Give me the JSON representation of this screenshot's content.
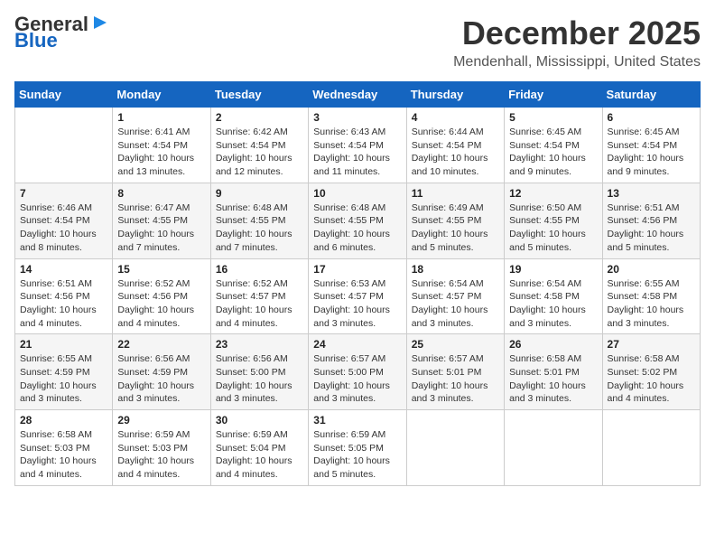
{
  "header": {
    "logo_line1": "General",
    "logo_line2": "Blue",
    "month_title": "December 2025",
    "location": "Mendenhall, Mississippi, United States"
  },
  "days_of_week": [
    "Sunday",
    "Monday",
    "Tuesday",
    "Wednesday",
    "Thursday",
    "Friday",
    "Saturday"
  ],
  "weeks": [
    [
      {
        "day": "",
        "info": ""
      },
      {
        "day": "1",
        "info": "Sunrise: 6:41 AM\nSunset: 4:54 PM\nDaylight: 10 hours\nand 13 minutes."
      },
      {
        "day": "2",
        "info": "Sunrise: 6:42 AM\nSunset: 4:54 PM\nDaylight: 10 hours\nand 12 minutes."
      },
      {
        "day": "3",
        "info": "Sunrise: 6:43 AM\nSunset: 4:54 PM\nDaylight: 10 hours\nand 11 minutes."
      },
      {
        "day": "4",
        "info": "Sunrise: 6:44 AM\nSunset: 4:54 PM\nDaylight: 10 hours\nand 10 minutes."
      },
      {
        "day": "5",
        "info": "Sunrise: 6:45 AM\nSunset: 4:54 PM\nDaylight: 10 hours\nand 9 minutes."
      },
      {
        "day": "6",
        "info": "Sunrise: 6:45 AM\nSunset: 4:54 PM\nDaylight: 10 hours\nand 9 minutes."
      }
    ],
    [
      {
        "day": "7",
        "info": "Sunrise: 6:46 AM\nSunset: 4:54 PM\nDaylight: 10 hours\nand 8 minutes."
      },
      {
        "day": "8",
        "info": "Sunrise: 6:47 AM\nSunset: 4:55 PM\nDaylight: 10 hours\nand 7 minutes."
      },
      {
        "day": "9",
        "info": "Sunrise: 6:48 AM\nSunset: 4:55 PM\nDaylight: 10 hours\nand 7 minutes."
      },
      {
        "day": "10",
        "info": "Sunrise: 6:48 AM\nSunset: 4:55 PM\nDaylight: 10 hours\nand 6 minutes."
      },
      {
        "day": "11",
        "info": "Sunrise: 6:49 AM\nSunset: 4:55 PM\nDaylight: 10 hours\nand 5 minutes."
      },
      {
        "day": "12",
        "info": "Sunrise: 6:50 AM\nSunset: 4:55 PM\nDaylight: 10 hours\nand 5 minutes."
      },
      {
        "day": "13",
        "info": "Sunrise: 6:51 AM\nSunset: 4:56 PM\nDaylight: 10 hours\nand 5 minutes."
      }
    ],
    [
      {
        "day": "14",
        "info": "Sunrise: 6:51 AM\nSunset: 4:56 PM\nDaylight: 10 hours\nand 4 minutes."
      },
      {
        "day": "15",
        "info": "Sunrise: 6:52 AM\nSunset: 4:56 PM\nDaylight: 10 hours\nand 4 minutes."
      },
      {
        "day": "16",
        "info": "Sunrise: 6:52 AM\nSunset: 4:57 PM\nDaylight: 10 hours\nand 4 minutes."
      },
      {
        "day": "17",
        "info": "Sunrise: 6:53 AM\nSunset: 4:57 PM\nDaylight: 10 hours\nand 3 minutes."
      },
      {
        "day": "18",
        "info": "Sunrise: 6:54 AM\nSunset: 4:57 PM\nDaylight: 10 hours\nand 3 minutes."
      },
      {
        "day": "19",
        "info": "Sunrise: 6:54 AM\nSunset: 4:58 PM\nDaylight: 10 hours\nand 3 minutes."
      },
      {
        "day": "20",
        "info": "Sunrise: 6:55 AM\nSunset: 4:58 PM\nDaylight: 10 hours\nand 3 minutes."
      }
    ],
    [
      {
        "day": "21",
        "info": "Sunrise: 6:55 AM\nSunset: 4:59 PM\nDaylight: 10 hours\nand 3 minutes."
      },
      {
        "day": "22",
        "info": "Sunrise: 6:56 AM\nSunset: 4:59 PM\nDaylight: 10 hours\nand 3 minutes."
      },
      {
        "day": "23",
        "info": "Sunrise: 6:56 AM\nSunset: 5:00 PM\nDaylight: 10 hours\nand 3 minutes."
      },
      {
        "day": "24",
        "info": "Sunrise: 6:57 AM\nSunset: 5:00 PM\nDaylight: 10 hours\nand 3 minutes."
      },
      {
        "day": "25",
        "info": "Sunrise: 6:57 AM\nSunset: 5:01 PM\nDaylight: 10 hours\nand 3 minutes."
      },
      {
        "day": "26",
        "info": "Sunrise: 6:58 AM\nSunset: 5:01 PM\nDaylight: 10 hours\nand 3 minutes."
      },
      {
        "day": "27",
        "info": "Sunrise: 6:58 AM\nSunset: 5:02 PM\nDaylight: 10 hours\nand 4 minutes."
      }
    ],
    [
      {
        "day": "28",
        "info": "Sunrise: 6:58 AM\nSunset: 5:03 PM\nDaylight: 10 hours\nand 4 minutes."
      },
      {
        "day": "29",
        "info": "Sunrise: 6:59 AM\nSunset: 5:03 PM\nDaylight: 10 hours\nand 4 minutes."
      },
      {
        "day": "30",
        "info": "Sunrise: 6:59 AM\nSunset: 5:04 PM\nDaylight: 10 hours\nand 4 minutes."
      },
      {
        "day": "31",
        "info": "Sunrise: 6:59 AM\nSunset: 5:05 PM\nDaylight: 10 hours\nand 5 minutes."
      },
      {
        "day": "",
        "info": ""
      },
      {
        "day": "",
        "info": ""
      },
      {
        "day": "",
        "info": ""
      }
    ]
  ]
}
